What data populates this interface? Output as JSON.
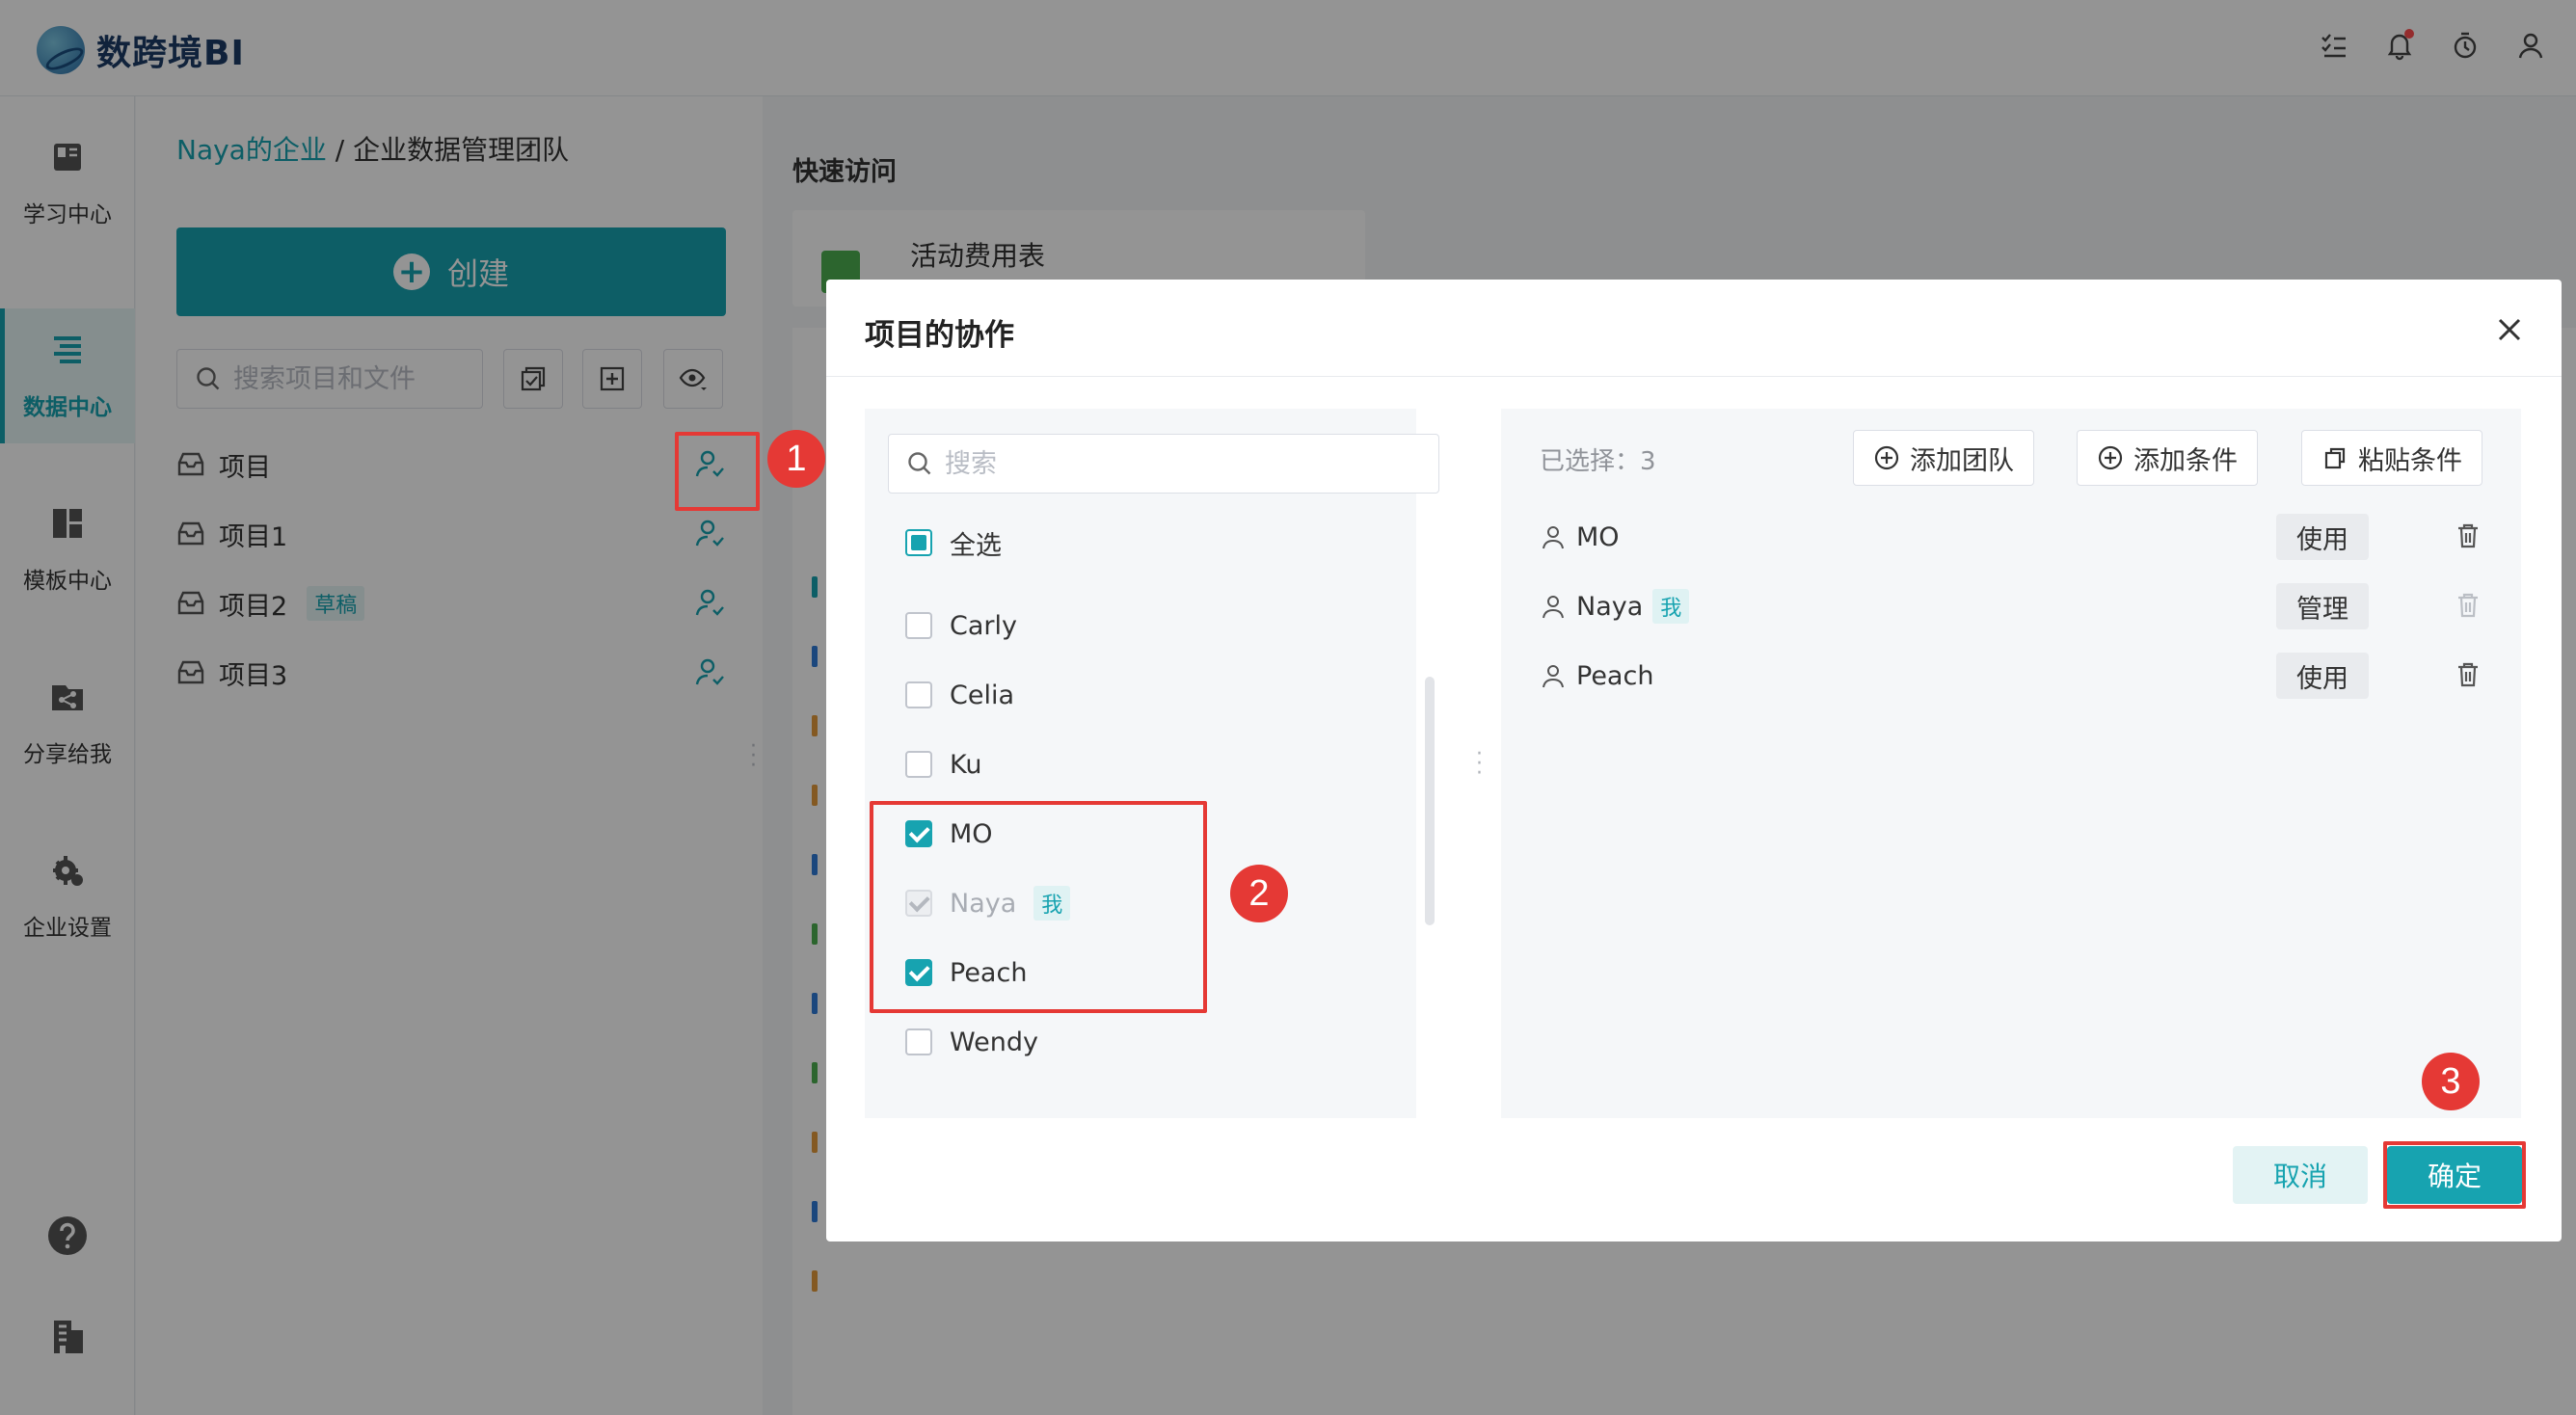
{
  "app": {
    "logo_text": "数跨境BI"
  },
  "topbar": {
    "icons": [
      "task-list-icon",
      "bell-icon",
      "timer-icon",
      "user-icon"
    ]
  },
  "nav": {
    "items": [
      {
        "label": "学习中心",
        "icon": "book-icon"
      },
      {
        "label": "数据中心",
        "icon": "data-list-icon",
        "active": true
      },
      {
        "label": "模板中心",
        "icon": "template-icon"
      },
      {
        "label": "分享给我",
        "icon": "share-icon"
      },
      {
        "label": "企业设置",
        "icon": "gear-icon"
      }
    ],
    "bottom_icons": [
      "help-icon",
      "building-icon"
    ]
  },
  "project_panel": {
    "breadcrumb": {
      "enterprise": "Naya的企业",
      "separator": "/",
      "team": "企业数据管理团队"
    },
    "create_label": "创建",
    "search_placeholder": "搜索项目和文件",
    "projects": [
      {
        "name": "项目"
      },
      {
        "name": "项目1"
      },
      {
        "name": "项目2",
        "badge": "草稿"
      },
      {
        "name": "项目3"
      }
    ]
  },
  "main": {
    "quick_access_title": "快速访问",
    "quick_card": {
      "name": "活动费用表"
    }
  },
  "modal": {
    "title": "项目的协作",
    "search_placeholder": "搜索",
    "select_all_label": "全选",
    "members": [
      {
        "name": "Carly",
        "checked": false
      },
      {
        "name": "Celia",
        "checked": false
      },
      {
        "name": "Ku",
        "checked": false
      },
      {
        "name": "MO",
        "checked": true
      },
      {
        "name": "Naya",
        "checked": true,
        "disabled": true,
        "tag": "我"
      },
      {
        "name": "Peach",
        "checked": true
      },
      {
        "name": "Wendy",
        "checked": false
      }
    ],
    "selected_count_label": "已选择：3",
    "actions": {
      "add_team": "添加团队",
      "add_condition": "添加条件",
      "paste_condition": "粘贴条件"
    },
    "selected": [
      {
        "name": "MO",
        "role": "使用"
      },
      {
        "name": "Naya",
        "role": "管理",
        "tag": "我"
      },
      {
        "name": "Peach",
        "role": "使用"
      }
    ],
    "cancel_label": "取消",
    "ok_label": "确定"
  },
  "annotations": {
    "step1": "1",
    "step2": "2",
    "step3": "3",
    "color": "#e53935"
  },
  "colors": {
    "accent": "#17a3b0",
    "overlay": "rgba(0,0,0,0.42)"
  }
}
